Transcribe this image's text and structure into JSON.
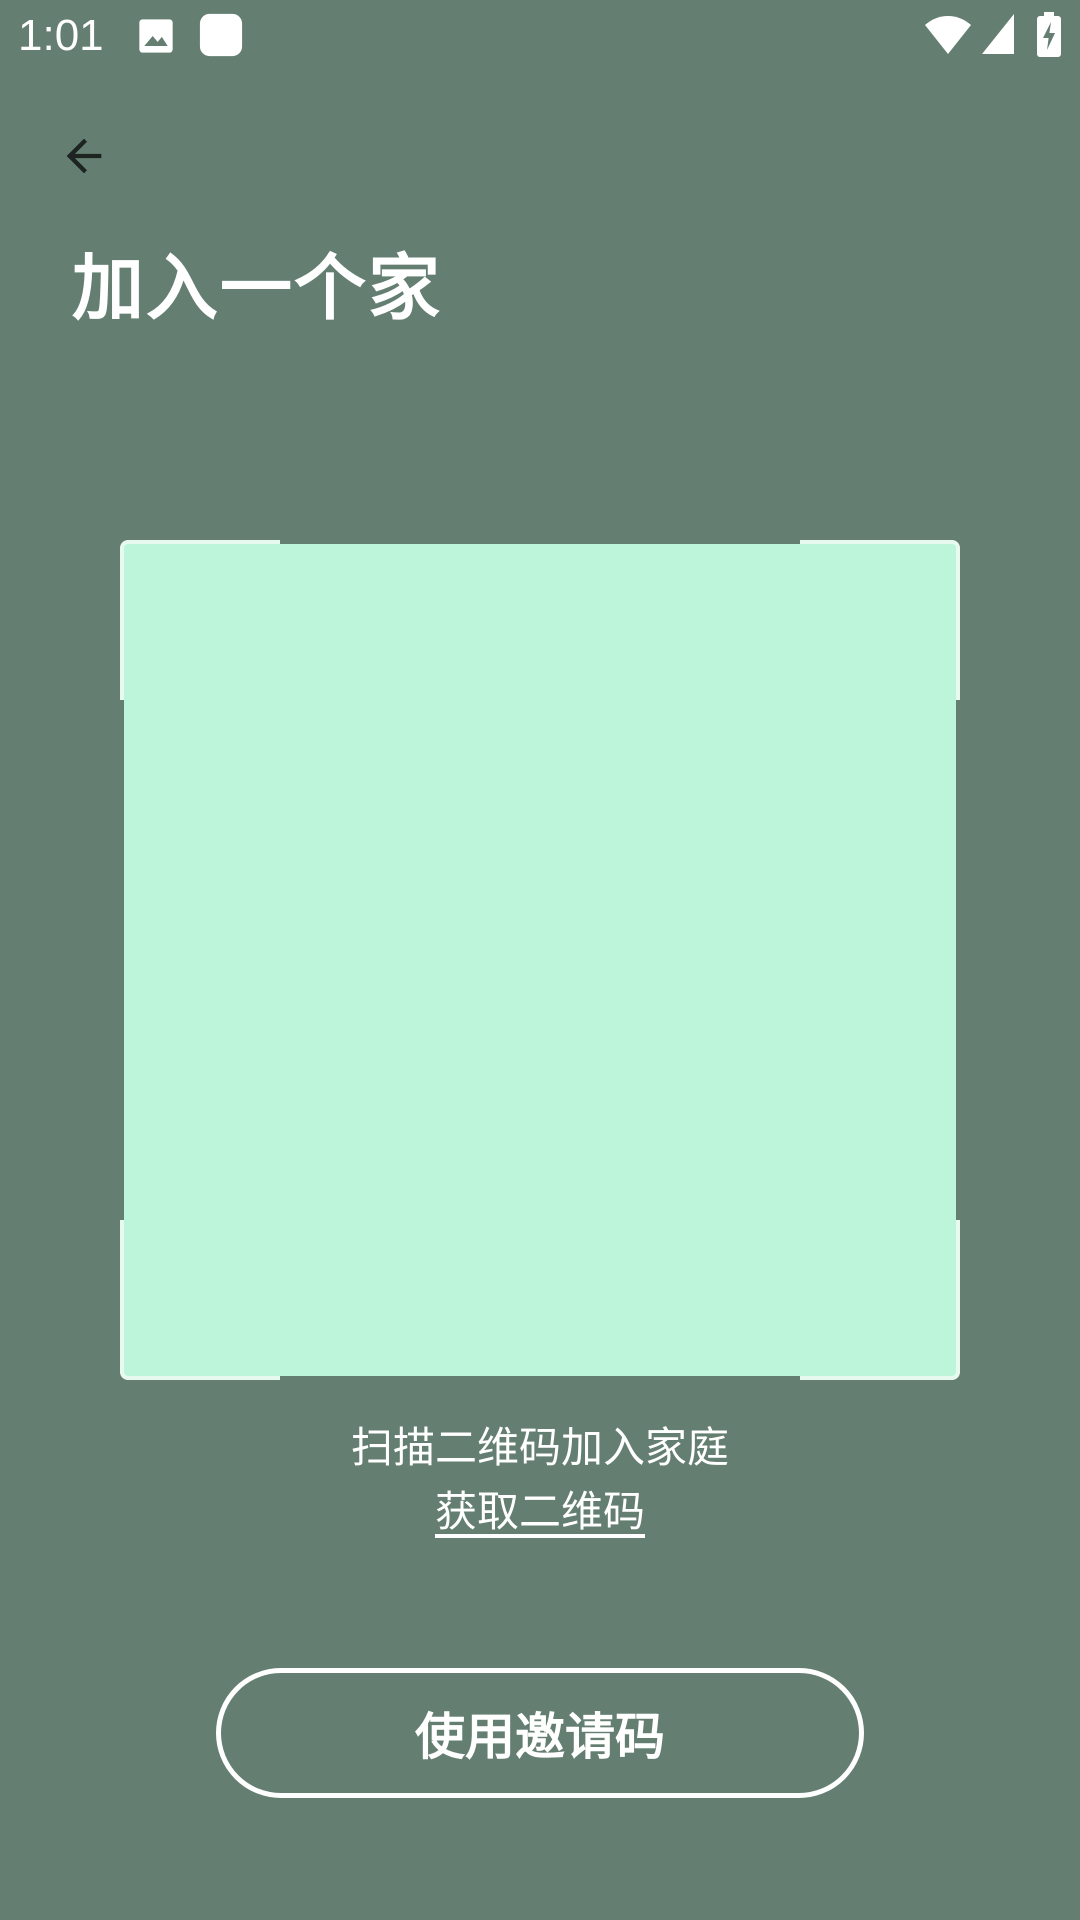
{
  "status_bar": {
    "time": "1:01",
    "icons": [
      "image-icon",
      "app-icon",
      "wifi-icon",
      "signal-icon",
      "battery-charging-icon"
    ]
  },
  "header": {
    "back_icon": "arrow-left-icon",
    "title": "加入一个家"
  },
  "scanner": {
    "area_color": "#bdf5da",
    "corner_color": "#e8faf0",
    "hint": "扫描二维码加入家庭",
    "get_qr_link": "获取二维码"
  },
  "actions": {
    "invite_code_button": "使用邀请码"
  },
  "colors": {
    "background": "#647f71",
    "text": "#ffffff",
    "back_arrow": "#1e2422"
  }
}
